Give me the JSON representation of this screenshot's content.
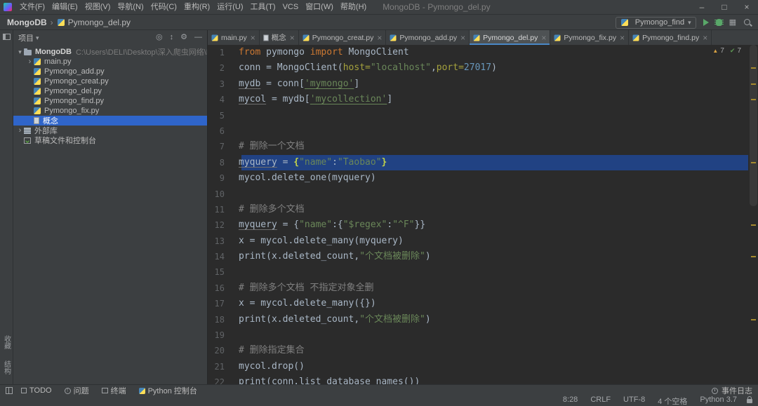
{
  "window": {
    "title": "MongoDB - Pymongo_del.py",
    "menu": [
      "文件(F)",
      "编辑(E)",
      "视图(V)",
      "导航(N)",
      "代码(C)",
      "重构(R)",
      "运行(U)",
      "工具(T)",
      "VCS",
      "窗口(W)",
      "帮助(H)"
    ],
    "controls": {
      "minimize": "–",
      "maximize": "□",
      "close": "×"
    }
  },
  "navbar": {
    "breadcrumb_root": "MongoDB",
    "breadcrumb_file": "Pymongo_del.py",
    "run_config": "Pymongo_find"
  },
  "left_stripe": {
    "labels": [
      "收藏",
      "结构"
    ]
  },
  "project": {
    "header": "项目",
    "tree": [
      {
        "label": "MongoDB",
        "path": "C:\\Users\\DELI\\Desktop\\深入爬虫网络\\MongoDB",
        "icon": "folder",
        "chevron": "down",
        "indent": 0,
        "bold": true
      },
      {
        "label": "main.py",
        "icon": "python",
        "chevron": "right",
        "indent": 1
      },
      {
        "label": "Pymongo_add.py",
        "icon": "python",
        "indent": 1
      },
      {
        "label": "Pymongo_creat.py",
        "icon": "python",
        "indent": 1
      },
      {
        "label": "Pymongo_del.py",
        "icon": "python",
        "indent": 1
      },
      {
        "label": "Pymongo_find.py",
        "icon": "python",
        "indent": 1
      },
      {
        "label": "Pymongo_fix.py",
        "icon": "python",
        "indent": 1
      },
      {
        "label": "概念",
        "icon": "file",
        "indent": 1,
        "selected": true
      },
      {
        "label": "外部库",
        "icon": "library",
        "chevron": "right",
        "indent": 0
      },
      {
        "label": "草稿文件和控制台",
        "icon": "console",
        "indent": 0
      }
    ]
  },
  "tabs": [
    {
      "label": "main.py",
      "icon": "python"
    },
    {
      "label": "概念",
      "icon": "file"
    },
    {
      "label": "Pymongo_creat.py",
      "icon": "python"
    },
    {
      "label": "Pymongo_add.py",
      "icon": "python"
    },
    {
      "label": "Pymongo_del.py",
      "icon": "python",
      "active": true
    },
    {
      "label": "Pymongo_fix.py",
      "icon": "python"
    },
    {
      "label": "Pymongo_find.py",
      "icon": "python"
    }
  ],
  "inspections": {
    "warnings": "7",
    "typos": "7"
  },
  "editor": {
    "lines": [
      {
        "n": 1,
        "tokens": [
          [
            "kw",
            "from"
          ],
          [
            "pl",
            " pymongo "
          ],
          [
            "kw",
            "import"
          ],
          [
            "pl",
            " MongoClient"
          ]
        ]
      },
      {
        "n": 2,
        "tokens": [
          [
            "pl",
            "conn = MongoClient("
          ],
          [
            "pr",
            "host="
          ],
          [
            "st",
            "\"localhost\""
          ],
          [
            "pl",
            ","
          ],
          [
            "pr",
            "port="
          ],
          [
            "nu",
            "27017"
          ],
          [
            "pl",
            ")"
          ]
        ]
      },
      {
        "n": 3,
        "tokens": [
          [
            "vu",
            "mydb"
          ],
          [
            "pl",
            " = conn["
          ],
          [
            "su",
            "'mymongo'"
          ],
          [
            "pl",
            "]"
          ]
        ]
      },
      {
        "n": 4,
        "tokens": [
          [
            "vu",
            "mycol"
          ],
          [
            "pl",
            " = mydb["
          ],
          [
            "su",
            "'mycollection'"
          ],
          [
            "pl",
            "]"
          ]
        ]
      },
      {
        "n": 5,
        "tokens": []
      },
      {
        "n": 6,
        "tokens": []
      },
      {
        "n": 7,
        "tokens": [
          [
            "co",
            "# 删除一个文档"
          ]
        ]
      },
      {
        "n": 8,
        "selected": true,
        "tokens": [
          [
            "vu",
            "myquery"
          ],
          [
            "pl",
            " = "
          ],
          [
            "br",
            "{"
          ],
          [
            "st",
            "\"name\""
          ],
          [
            "pl",
            ":"
          ],
          [
            "st",
            "\"Taobao\""
          ],
          [
            "br",
            "}"
          ]
        ]
      },
      {
        "n": 9,
        "tokens": [
          [
            "pl",
            "mycol.delete_one(myquery)"
          ]
        ]
      },
      {
        "n": 10,
        "tokens": []
      },
      {
        "n": 11,
        "tokens": [
          [
            "co",
            "# 删除多个文档"
          ]
        ]
      },
      {
        "n": 12,
        "tokens": [
          [
            "vu",
            "myquery"
          ],
          [
            "pl",
            " = {"
          ],
          [
            "st",
            "\"name\""
          ],
          [
            "pl",
            ":{"
          ],
          [
            "st",
            "\"$regex\""
          ],
          [
            "pl",
            ":"
          ],
          [
            "st",
            "\"^F\""
          ],
          [
            "pl",
            "}}"
          ]
        ]
      },
      {
        "n": 13,
        "tokens": [
          [
            "pl",
            "x = mycol.delete_many(myquery)"
          ]
        ]
      },
      {
        "n": 14,
        "tokens": [
          [
            "pl",
            "print(x.deleted_count,"
          ],
          [
            "st",
            "\"个文档被删除\""
          ],
          [
            "pl",
            ")"
          ]
        ]
      },
      {
        "n": 15,
        "tokens": []
      },
      {
        "n": 16,
        "tokens": [
          [
            "co",
            "# 删除多个文档 不指定对象全删"
          ]
        ]
      },
      {
        "n": 17,
        "tokens": [
          [
            "pl",
            "x = mycol.delete_many({})"
          ]
        ]
      },
      {
        "n": 18,
        "tokens": [
          [
            "pl",
            "print(x.deleted_count,"
          ],
          [
            "st",
            "\"个文档被删除\""
          ],
          [
            "pl",
            ")"
          ]
        ]
      },
      {
        "n": 19,
        "tokens": []
      },
      {
        "n": 20,
        "tokens": [
          [
            "co",
            "# 删除指定集合"
          ]
        ]
      },
      {
        "n": 21,
        "tokens": [
          [
            "pl",
            "mycol.drop()"
          ]
        ]
      },
      {
        "n": 22,
        "tokens": [
          [
            "pl",
            "print(conn.list_database_names())"
          ]
        ]
      }
    ]
  },
  "bottom_bar": {
    "left": [
      {
        "label": "TODO",
        "icon": "todo"
      },
      {
        "label": "问题",
        "icon": "problems"
      },
      {
        "label": "终端",
        "icon": "terminal"
      },
      {
        "label": "Python 控制台",
        "icon": "python-console"
      }
    ],
    "event_log": "事件日志"
  },
  "status_bar": {
    "items": [
      "8:28",
      "CRLF",
      "UTF-8",
      "4 个空格",
      "Python 3.7"
    ]
  },
  "colors": {
    "bg_panel": "#3c3f41",
    "bg_editor": "#2b2b2b",
    "selection_blue": "#2f65ca",
    "line_selection": "#214283",
    "tab_underline": "#4a88c7",
    "kw": "#cc7832",
    "str": "#6a8759",
    "num": "#6897bb",
    "com": "#808080",
    "param": "#a5a23d",
    "code": "#a9b7c6",
    "gutter": "#606366",
    "run_green": "#59a869",
    "warn_yellow": "#d9a343"
  }
}
